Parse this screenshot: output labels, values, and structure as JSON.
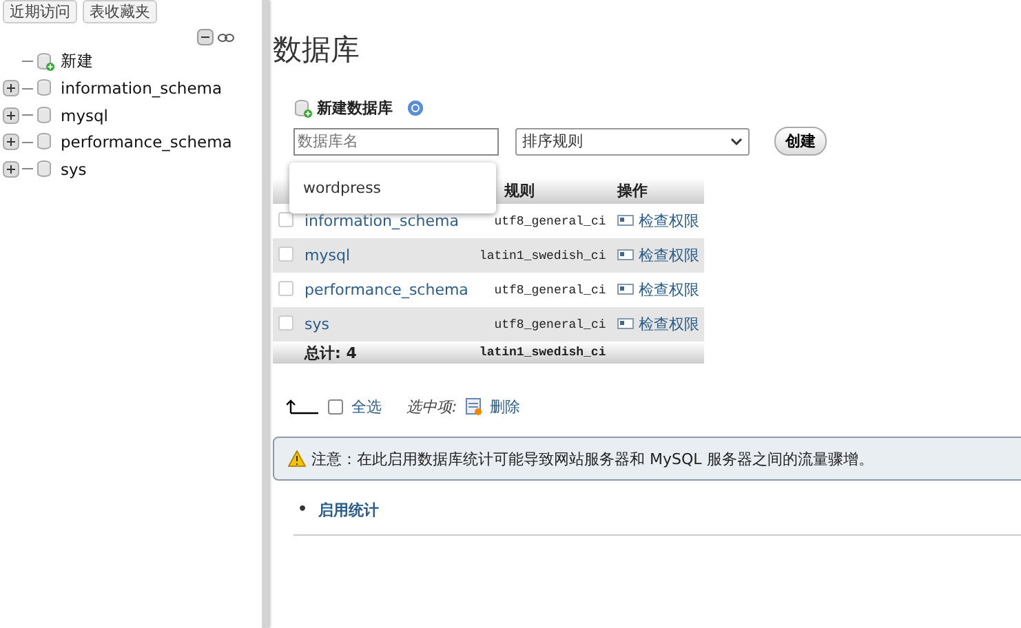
{
  "sidebar": {
    "tabs": [
      {
        "label": "近期访问"
      },
      {
        "label": "表收藏夹"
      }
    ],
    "tree": [
      {
        "label": "新建",
        "kind": "new"
      },
      {
        "label": "information_schema",
        "kind": "db"
      },
      {
        "label": "mysql",
        "kind": "db"
      },
      {
        "label": "performance_schema",
        "kind": "db"
      },
      {
        "label": "sys",
        "kind": "db"
      }
    ]
  },
  "main": {
    "title": "数据库",
    "create": {
      "heading": "新建数据库",
      "name_field": {
        "placeholder": "数据库名"
      },
      "collation_select": {
        "value": "排序规则"
      },
      "button": "创建",
      "suggestions": [
        "wordpress"
      ]
    },
    "table": {
      "columns": {
        "collation": "规则",
        "actions": "操作"
      },
      "rows": [
        {
          "name": "information_schema",
          "collation": "utf8_general_ci",
          "action": "检查权限",
          "checked": false
        },
        {
          "name": "mysql",
          "collation": "latin1_swedish_ci",
          "action": "检查权限",
          "checked": false
        },
        {
          "name": "performance_schema",
          "collation": "utf8_general_ci",
          "action": "检查权限",
          "checked": false
        },
        {
          "name": "sys",
          "collation": "utf8_general_ci",
          "action": "检查权限",
          "checked": false
        }
      ],
      "total": {
        "label": "总计: 4",
        "collation": "latin1_swedish_ci"
      }
    },
    "bulk": {
      "select_all": "全选",
      "checked": false,
      "with_selected": "选中项:",
      "drop": "删除"
    },
    "notice": "注意：在此启用数据库统计可能导致网站服务器和 MySQL 服务器之间的流量骤增。",
    "links": [
      {
        "bullet": "•",
        "label": "启用统计"
      }
    ]
  }
}
